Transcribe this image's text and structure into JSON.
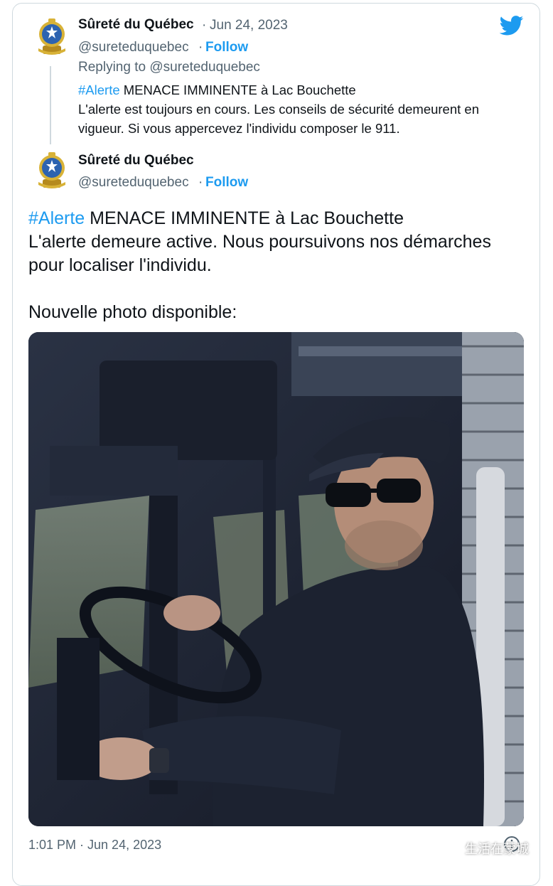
{
  "quoted_tweet": {
    "author_name": "Sûreté du Québec",
    "separator": "·",
    "date": "Jun 24, 2023",
    "handle": "@sureteduquebec",
    "follow_label": "Follow",
    "replying_to": "Replying to @sureteduquebec",
    "hashtag": "#Alerte",
    "headline_rest": " MENACE IMMINENTE à Lac Bouchette",
    "body_line1": "L'alerte est toujours en cours. Les conseils de sécurité demeurent en",
    "body_line2": "vigueur. Si vous appercevez l'individu composer le 911."
  },
  "main_tweet": {
    "author_name": "Sûreté du Québec",
    "handle": "@sureteduquebec",
    "follow_label": "Follow",
    "hashtag": "#Alerte",
    "headline_rest": " MENACE IMMINENTE à Lac Bouchette",
    "body_line1": "L'alerte demeure active. Nous poursuivons nos démarches",
    "body_line2": "pour localiser l'individu.",
    "body_line3": "Nouvelle photo disponible:",
    "timestamp": "1:01 PM · Jun 24, 2023"
  },
  "watermark": "生活在蒙城",
  "icons": {
    "brand": "twitter-bird-icon",
    "avatar": "police-badge-logo",
    "info": "info-circle-icon",
    "watermark": "wechat-icon"
  },
  "colors": {
    "accent": "#1d9bf0",
    "text_primary": "#0f1419",
    "text_secondary": "#536471",
    "border": "#cfd9de"
  }
}
